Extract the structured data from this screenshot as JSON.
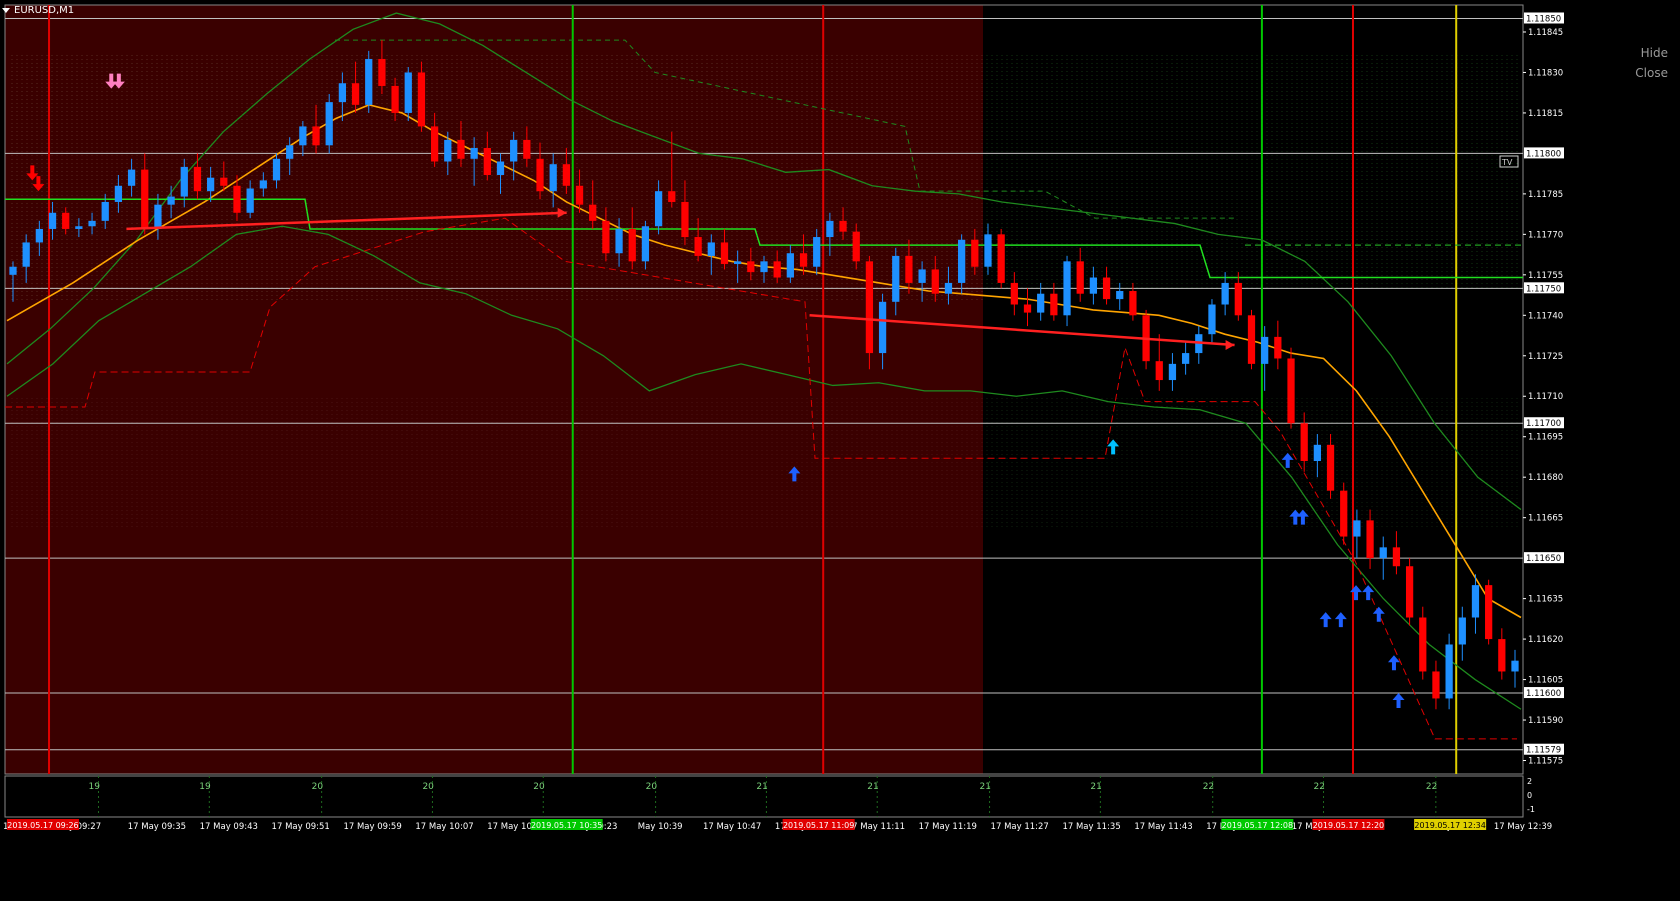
{
  "window": {
    "symbol_title": "EURUSD,M1",
    "hide_label": "Hide",
    "close_label": "Close",
    "tv_label": "TV"
  },
  "colors": {
    "background": "#000000",
    "session_fill": "#3a0000",
    "bull_candle": "#1e90ff",
    "bear_candle": "#ff0000",
    "ma_line": "#ffa500",
    "band_line": "#1e7a1e",
    "grid_line": "#c0c0c0",
    "axis_text": "#ffffff",
    "green_vline": "#00c800",
    "red_vline": "#e00000",
    "yellow_vline": "#e0d000"
  },
  "chart_data": {
    "type": "candlestick",
    "title": "EURUSD,M1",
    "y_range": [
      1.1157,
      1.11855
    ],
    "y_ticks": [
      "1.11845",
      "1.11830",
      "1.11815",
      "1.11785",
      "1.11770",
      "1.11755",
      "1.11740",
      "1.11725",
      "1.11710",
      "1.11695",
      "1.11680",
      "1.11665",
      "1.11635",
      "1.11620",
      "1.11605",
      "1.11590",
      "1.11575"
    ],
    "price_labels": [
      "1.11850",
      "1.11800",
      "1.11750",
      "1.11700",
      "1.11650",
      "1.11600",
      "1.11579"
    ],
    "horizontal_levels": [
      1.1185,
      1.118,
      1.1175,
      1.117,
      1.1165,
      1.116,
      1.11579
    ],
    "time_labels": [
      "y 09:27",
      "17 May 09:35",
      "17 May 09:43",
      "17 May 09:51",
      "17 May 09:59",
      "17 May 10:07",
      "17 May 10:15",
      "17 May 10:23",
      "May 10:39",
      "17 May 10:47",
      "17 May 10:55",
      "17 May 11:11",
      "17 May 11:19",
      "17 May 11:27",
      "17 May 11:35",
      "17 May 11:43",
      "17 May 11:51",
      "17 May",
      "07",
      "May 12:",
      "17 May 12:39"
    ],
    "highlight_time_labels": [
      {
        "text": "2019.05.17 09:26",
        "color": "#e00000"
      },
      {
        "text": "2019.05.17 10:35",
        "color": "#00c800"
      },
      {
        "text": "2019.05.17 11:09",
        "color": "#e00000"
      },
      {
        "text": "2019.05.17 12:08",
        "color": "#00c800"
      },
      {
        "text": "2019.05.17 12:20",
        "color": "#e00000"
      },
      {
        "text": "2019.05.17 12:34",
        "color": "#e0d000"
      }
    ],
    "left_edge_label": "17",
    "subwindow_labels": [
      "19",
      "19",
      "20",
      "20",
      "20",
      "20",
      "21",
      "21",
      "21",
      "21",
      "22",
      "22",
      "22"
    ],
    "subwindow_scale": [
      "2",
      "0",
      "-1"
    ],
    "candles": [
      [
        1.11755,
        1.1176,
        1.11745,
        1.11758
      ],
      [
        1.11758,
        1.1177,
        1.11752,
        1.11767
      ],
      [
        1.11767,
        1.11775,
        1.11762,
        1.11772
      ],
      [
        1.11772,
        1.11782,
        1.11768,
        1.11778
      ],
      [
        1.11778,
        1.1178,
        1.1177,
        1.11772
      ],
      [
        1.11772,
        1.11776,
        1.11769,
        1.11773
      ],
      [
        1.11773,
        1.11778,
        1.1177,
        1.11775
      ],
      [
        1.11775,
        1.11785,
        1.11772,
        1.11782
      ],
      [
        1.11782,
        1.11792,
        1.11778,
        1.11788
      ],
      [
        1.11788,
        1.11798,
        1.11784,
        1.11794
      ],
      [
        1.11794,
        1.118,
        1.1177,
        1.11772
      ],
      [
        1.11772,
        1.11785,
        1.11768,
        1.11781
      ],
      [
        1.11781,
        1.11788,
        1.11776,
        1.11784
      ],
      [
        1.11784,
        1.11798,
        1.1178,
        1.11795
      ],
      [
        1.11795,
        1.118,
        1.11783,
        1.11786
      ],
      [
        1.11786,
        1.11795,
        1.11782,
        1.11791
      ],
      [
        1.11791,
        1.11797,
        1.11786,
        1.11788
      ],
      [
        1.11788,
        1.11792,
        1.11775,
        1.11778
      ],
      [
        1.11778,
        1.1179,
        1.11776,
        1.11787
      ],
      [
        1.11787,
        1.11793,
        1.11784,
        1.1179
      ],
      [
        1.1179,
        1.118,
        1.11787,
        1.11798
      ],
      [
        1.11798,
        1.11806,
        1.11792,
        1.11803
      ],
      [
        1.11803,
        1.11812,
        1.11799,
        1.1181
      ],
      [
        1.1181,
        1.11818,
        1.118,
        1.11803
      ],
      [
        1.11803,
        1.11822,
        1.118,
        1.11819
      ],
      [
        1.11819,
        1.1183,
        1.11812,
        1.11826
      ],
      [
        1.11826,
        1.11834,
        1.11815,
        1.11818
      ],
      [
        1.11818,
        1.11838,
        1.11815,
        1.11835
      ],
      [
        1.11835,
        1.11842,
        1.11822,
        1.11825
      ],
      [
        1.11825,
        1.11828,
        1.11812,
        1.11815
      ],
      [
        1.11815,
        1.11832,
        1.11812,
        1.1183
      ],
      [
        1.1183,
        1.11834,
        1.11808,
        1.1181
      ],
      [
        1.1181,
        1.11815,
        1.11795,
        1.11797
      ],
      [
        1.11797,
        1.11808,
        1.11792,
        1.11805
      ],
      [
        1.11805,
        1.11812,
        1.11795,
        1.11798
      ],
      [
        1.11798,
        1.11806,
        1.11788,
        1.11802
      ],
      [
        1.11802,
        1.11808,
        1.1179,
        1.11792
      ],
      [
        1.11792,
        1.118,
        1.11785,
        1.11797
      ],
      [
        1.11797,
        1.11808,
        1.1179,
        1.11805
      ],
      [
        1.11805,
        1.1181,
        1.11795,
        1.11798
      ],
      [
        1.11798,
        1.11804,
        1.11783,
        1.11786
      ],
      [
        1.11786,
        1.118,
        1.1178,
        1.11796
      ],
      [
        1.11796,
        1.11802,
        1.11785,
        1.11788
      ],
      [
        1.11788,
        1.11794,
        1.11778,
        1.11781
      ],
      [
        1.11781,
        1.1179,
        1.11772,
        1.11775
      ],
      [
        1.11775,
        1.1178,
        1.1176,
        1.11763
      ],
      [
        1.11763,
        1.11776,
        1.11758,
        1.11772
      ],
      [
        1.11772,
        1.1178,
        1.11757,
        1.1176
      ],
      [
        1.1176,
        1.11775,
        1.11757,
        1.11773
      ],
      [
        1.11773,
        1.1179,
        1.1177,
        1.11786
      ],
      [
        1.11786,
        1.11808,
        1.1178,
        1.11782
      ],
      [
        1.11782,
        1.1179,
        1.11766,
        1.11769
      ],
      [
        1.11769,
        1.11776,
        1.1176,
        1.11762
      ],
      [
        1.11762,
        1.1177,
        1.11755,
        1.11767
      ],
      [
        1.11767,
        1.11772,
        1.11757,
        1.11759
      ],
      [
        1.11759,
        1.11764,
        1.11752,
        1.1176
      ],
      [
        1.1176,
        1.11765,
        1.11753,
        1.11756
      ],
      [
        1.11756,
        1.11762,
        1.11752,
        1.1176
      ],
      [
        1.1176,
        1.11764,
        1.11752,
        1.11754
      ],
      [
        1.11754,
        1.11766,
        1.11752,
        1.11763
      ],
      [
        1.11763,
        1.1177,
        1.11755,
        1.11758
      ],
      [
        1.11758,
        1.11772,
        1.11755,
        1.11769
      ],
      [
        1.11769,
        1.11778,
        1.11762,
        1.11775
      ],
      [
        1.11775,
        1.1178,
        1.11768,
        1.11771
      ],
      [
        1.11771,
        1.11774,
        1.11757,
        1.1176
      ],
      [
        1.1176,
        1.11762,
        1.1172,
        1.11726
      ],
      [
        1.11726,
        1.11748,
        1.1172,
        1.11745
      ],
      [
        1.11745,
        1.11765,
        1.1174,
        1.11762
      ],
      [
        1.11762,
        1.11768,
        1.11748,
        1.11752
      ],
      [
        1.11752,
        1.1176,
        1.11745,
        1.11757
      ],
      [
        1.11757,
        1.11762,
        1.11745,
        1.11748
      ],
      [
        1.11748,
        1.11758,
        1.11744,
        1.11752
      ],
      [
        1.11752,
        1.1177,
        1.11748,
        1.11768
      ],
      [
        1.11768,
        1.11772,
        1.11755,
        1.11758
      ],
      [
        1.11758,
        1.11774,
        1.11755,
        1.1177
      ],
      [
        1.1177,
        1.11772,
        1.1175,
        1.11752
      ],
      [
        1.11752,
        1.11756,
        1.1174,
        1.11744
      ],
      [
        1.11744,
        1.1175,
        1.11736,
        1.11741
      ],
      [
        1.11741,
        1.11752,
        1.11738,
        1.11748
      ],
      [
        1.11748,
        1.11752,
        1.11738,
        1.1174
      ],
      [
        1.1174,
        1.11762,
        1.11736,
        1.1176
      ],
      [
        1.1176,
        1.11765,
        1.11745,
        1.11748
      ],
      [
        1.11748,
        1.11758,
        1.11744,
        1.11754
      ],
      [
        1.11754,
        1.11758,
        1.11744,
        1.11746
      ],
      [
        1.11746,
        1.11752,
        1.11742,
        1.11749
      ],
      [
        1.11749,
        1.11752,
        1.11738,
        1.1174
      ],
      [
        1.1174,
        1.11742,
        1.1172,
        1.11723
      ],
      [
        1.11723,
        1.11733,
        1.11712,
        1.11716
      ],
      [
        1.11716,
        1.11726,
        1.11712,
        1.11722
      ],
      [
        1.11722,
        1.1173,
        1.11718,
        1.11726
      ],
      [
        1.11726,
        1.11736,
        1.11722,
        1.11733
      ],
      [
        1.11733,
        1.11746,
        1.1173,
        1.11744
      ],
      [
        1.11744,
        1.11756,
        1.1174,
        1.11752
      ],
      [
        1.11752,
        1.11756,
        1.11738,
        1.1174
      ],
      [
        1.1174,
        1.11742,
        1.1172,
        1.11722
      ],
      [
        1.11722,
        1.11736,
        1.11712,
        1.11732
      ],
      [
        1.11732,
        1.11738,
        1.1172,
        1.11724
      ],
      [
        1.11724,
        1.11728,
        1.11698,
        1.117
      ],
      [
        1.117,
        1.11704,
        1.11682,
        1.11686
      ],
      [
        1.11686,
        1.11696,
        1.1168,
        1.11692
      ],
      [
        1.11692,
        1.11696,
        1.11672,
        1.11675
      ],
      [
        1.11675,
        1.11678,
        1.11655,
        1.11658
      ],
      [
        1.11658,
        1.11668,
        1.1165,
        1.11664
      ],
      [
        1.11664,
        1.11668,
        1.11646,
        1.1165
      ],
      [
        1.1165,
        1.11658,
        1.11642,
        1.11654
      ],
      [
        1.11654,
        1.1166,
        1.11644,
        1.11647
      ],
      [
        1.11647,
        1.1165,
        1.11625,
        1.11628
      ],
      [
        1.11628,
        1.11632,
        1.11605,
        1.11608
      ],
      [
        1.11608,
        1.11612,
        1.11594,
        1.11598
      ],
      [
        1.11598,
        1.11622,
        1.11594,
        1.11618
      ],
      [
        1.11618,
        1.11632,
        1.11612,
        1.11628
      ],
      [
        1.11628,
        1.11644,
        1.11622,
        1.1164
      ],
      [
        1.1164,
        1.11642,
        1.11618,
        1.1162
      ],
      [
        1.1162,
        1.11624,
        1.11605,
        1.11608
      ],
      [
        1.11608,
        1.11616,
        1.11602,
        1.11612
      ]
    ],
    "moving_average": [
      1.11738,
      1.11745,
      1.11752,
      1.1176,
      1.11768,
      1.11775,
      1.11782,
      1.1179,
      1.11798,
      1.11806,
      1.11813,
      1.11818,
      1.11815,
      1.11808,
      1.11802,
      1.11796,
      1.1179,
      1.11782,
      1.11776,
      1.1177,
      1.11766,
      1.11763,
      1.1176,
      1.11758,
      1.11757,
      1.11755,
      1.11753,
      1.11751,
      1.11749,
      1.11748,
      1.11747,
      1.11746,
      1.11744,
      1.11742,
      1.11741,
      1.1174,
      1.11737,
      1.11733,
      1.1173,
      1.11726,
      1.11724,
      1.11712,
      1.11695,
      1.11675,
      1.11655,
      1.11635,
      1.11628
    ],
    "upper_band": [
      1.11722,
      1.11735,
      1.1175,
      1.11768,
      1.1179,
      1.11808,
      1.11822,
      1.11835,
      1.11846,
      1.11852,
      1.11848,
      1.1184,
      1.1183,
      1.1182,
      1.11812,
      1.11806,
      1.118,
      1.11798,
      1.11793,
      1.11794,
      1.11788,
      1.11786,
      1.11785,
      1.11782,
      1.1178,
      1.11778,
      1.11776,
      1.11774,
      1.1177,
      1.11768,
      1.1176,
      1.11745,
      1.11725,
      1.117,
      1.1168,
      1.11668
    ],
    "lower_band": [
      1.1171,
      1.11722,
      1.11738,
      1.11748,
      1.11758,
      1.1177,
      1.11773,
      1.1177,
      1.11762,
      1.11752,
      1.11748,
      1.1174,
      1.11735,
      1.11725,
      1.11712,
      1.11718,
      1.11722,
      1.11718,
      1.11714,
      1.11715,
      1.11712,
      1.11712,
      1.1171,
      1.11712,
      1.11708,
      1.11706,
      1.11705,
      1.117,
      1.1168,
      1.11655,
      1.11635,
      1.11618,
      1.11605,
      1.11594
    ],
    "trend_arrows": [
      {
        "from": [
          0.08,
          1.11772
        ],
        "to": [
          0.37,
          1.11778
        ]
      },
      {
        "from": [
          0.53,
          1.1174
        ],
        "to": [
          0.81,
          1.11729
        ]
      }
    ],
    "signal_arrows_up": [
      [
        0.52,
        1.11684,
        "#1e60ff"
      ],
      [
        0.73,
        1.11694,
        "#00c0ff"
      ],
      [
        0.845,
        1.11689,
        "#1e60ff"
      ],
      [
        0.85,
        1.11668,
        "#1e60ff"
      ],
      [
        0.855,
        1.11668,
        "#1e60ff"
      ],
      [
        0.87,
        1.1163,
        "#1e60ff"
      ],
      [
        0.88,
        1.1163,
        "#1e60ff"
      ],
      [
        0.89,
        1.1164,
        "#1e60ff"
      ],
      [
        0.898,
        1.1164,
        "#1e60ff"
      ],
      [
        0.905,
        1.11632,
        "#1e60ff"
      ],
      [
        0.915,
        1.11614,
        "#1e60ff"
      ],
      [
        0.918,
        1.116,
        "#1e60ff"
      ],
      [
        0.925,
        1.11568,
        "#1e60ff"
      ]
    ],
    "signal_arrows_down": [
      [
        0.018,
        1.1179,
        "#ff0000"
      ],
      [
        0.022,
        1.11786,
        "#ff0000"
      ],
      [
        0.07,
        1.11824,
        "#ff80c0"
      ],
      [
        0.075,
        1.11824,
        "#ff80c0"
      ]
    ]
  }
}
